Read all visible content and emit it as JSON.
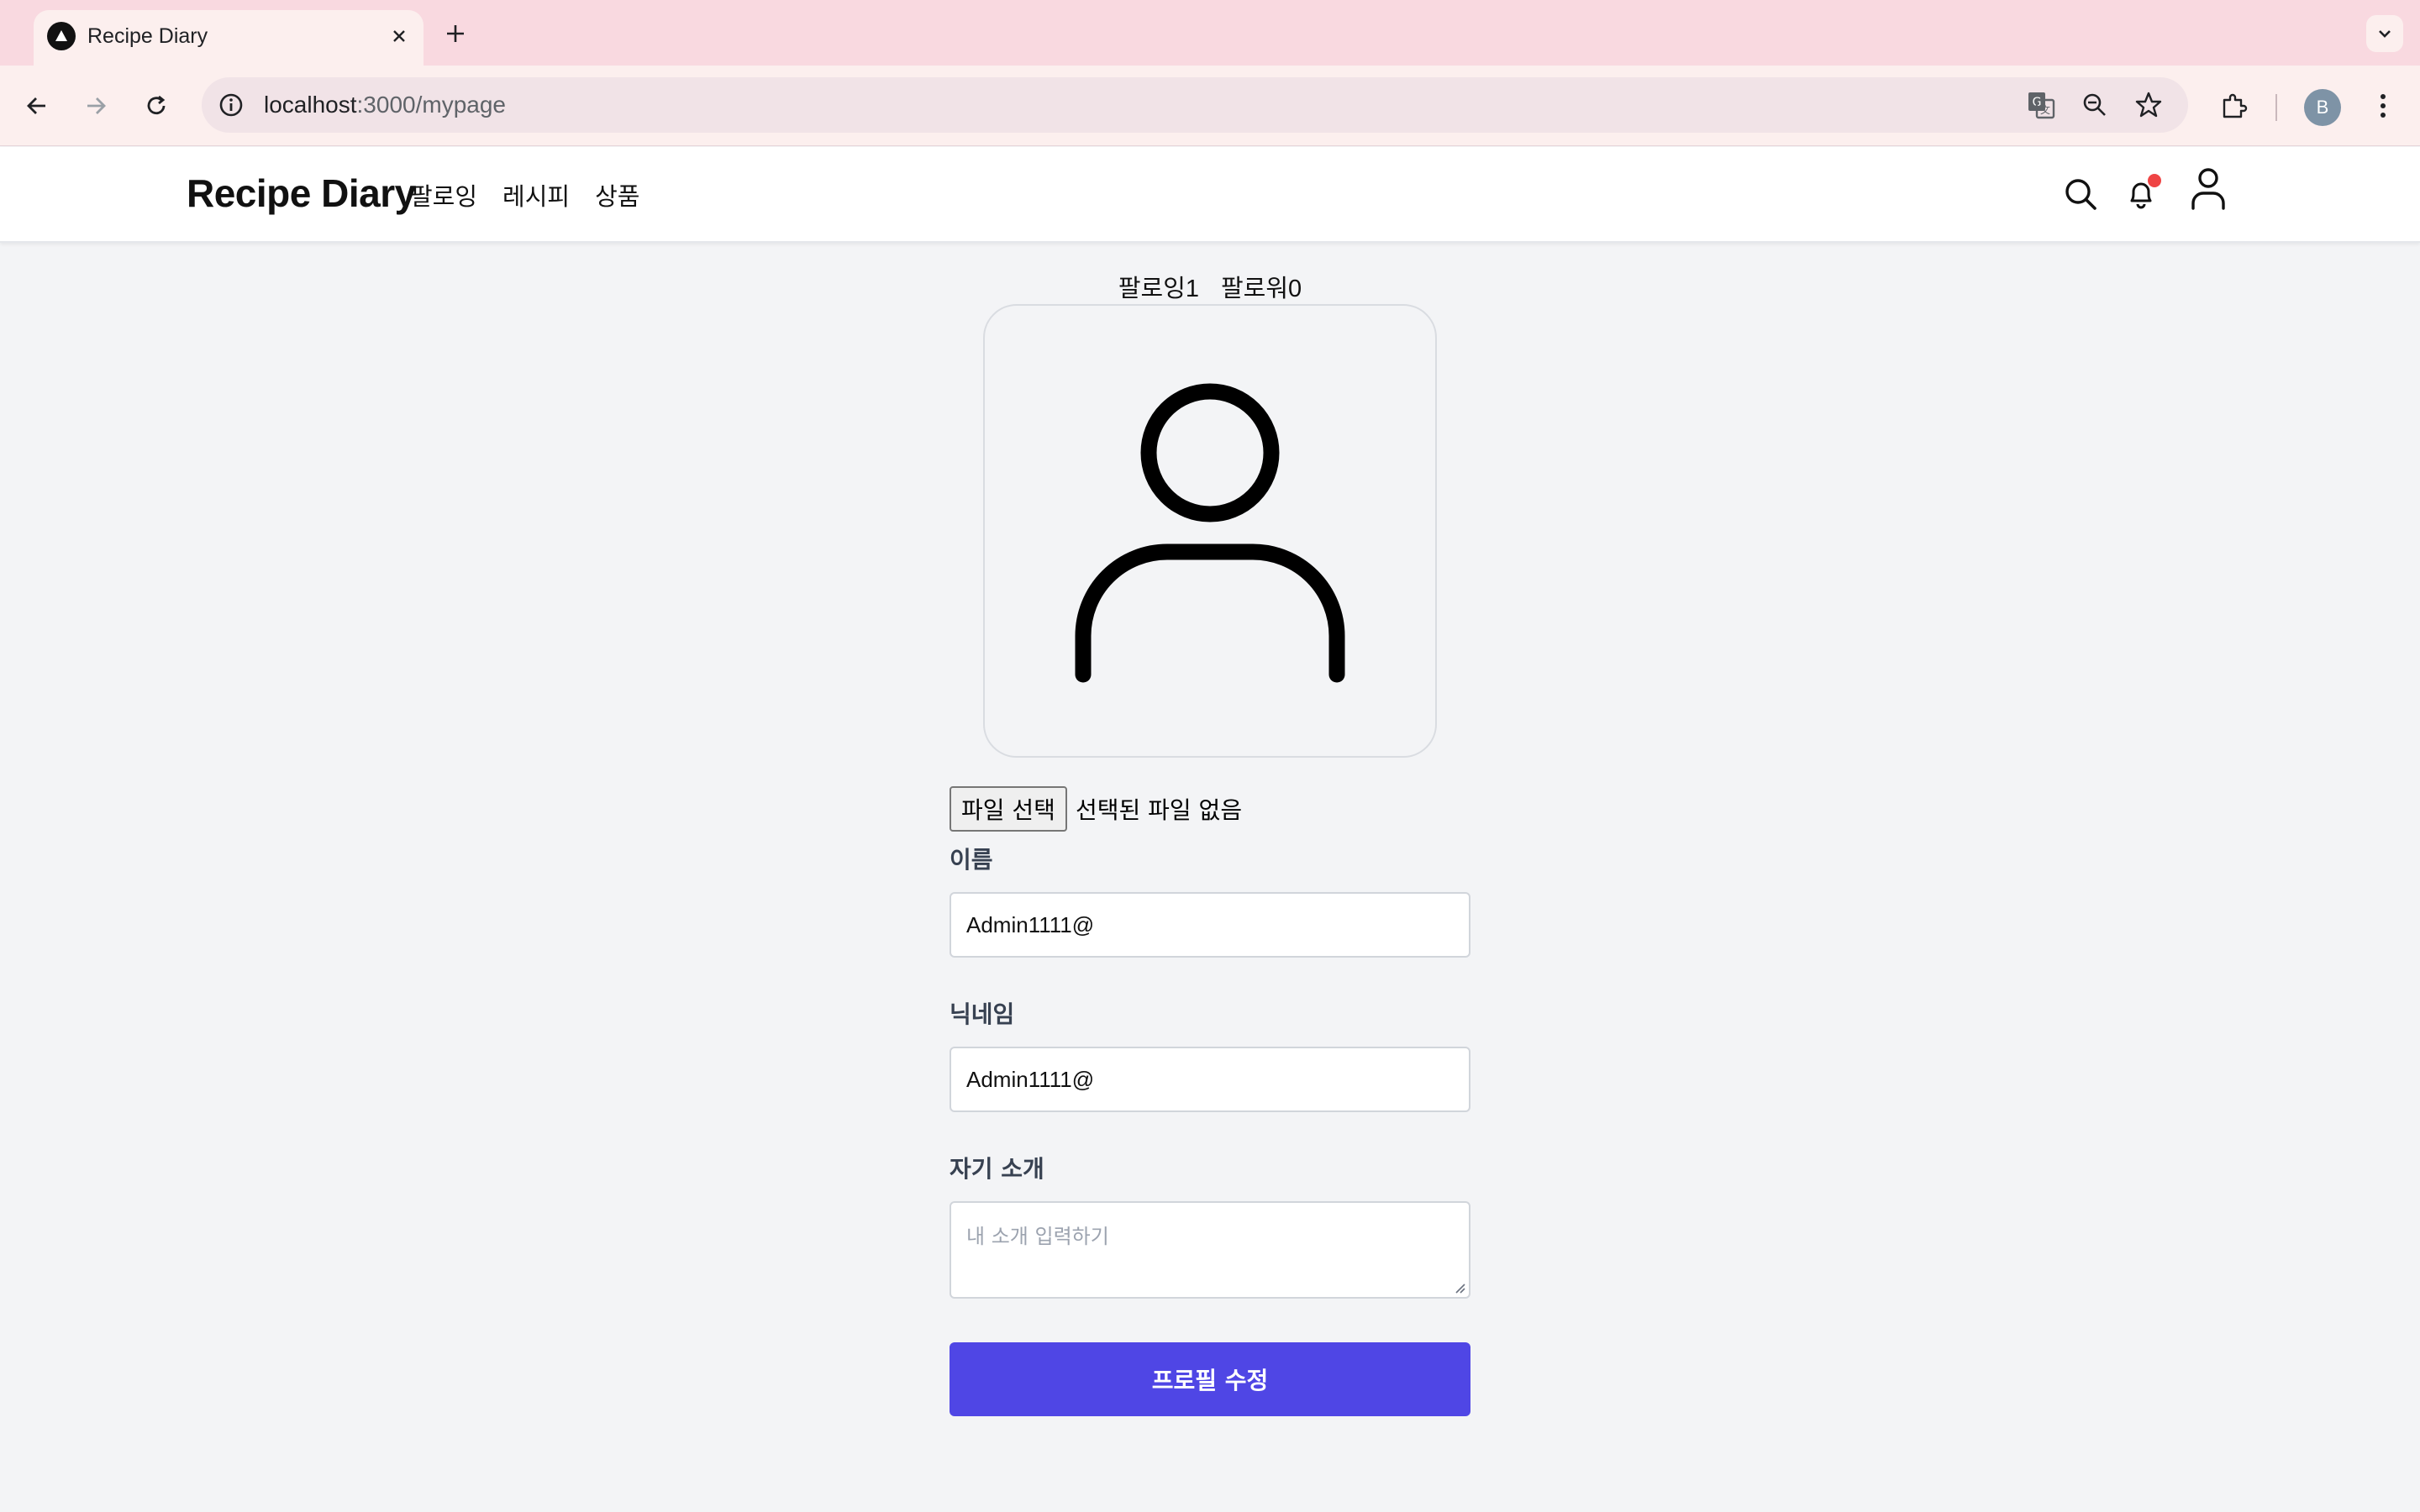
{
  "browser": {
    "tab_title": "Recipe Diary",
    "url_host": "localhost",
    "url_path": ":3000/mypage",
    "profile_initial": "B"
  },
  "header": {
    "brand": "Recipe Diary",
    "nav": [
      "팔로잉",
      "레시피",
      "상품"
    ],
    "notification_dot_color": "#ef4444"
  },
  "profile": {
    "following_label": "팔로잉1",
    "followers_label": "팔로워0",
    "file_button": "파일 선택",
    "file_status": "선택된 파일 없음"
  },
  "form": {
    "name_label": "이름",
    "name_value": "Admin1111@",
    "nickname_label": "닉네임",
    "nickname_value": "Admin1111@",
    "bio_label": "자기 소개",
    "bio_placeholder": "내 소개 입력하기",
    "submit_label": "프로필 수정",
    "submit_color": "#4f46e5"
  }
}
